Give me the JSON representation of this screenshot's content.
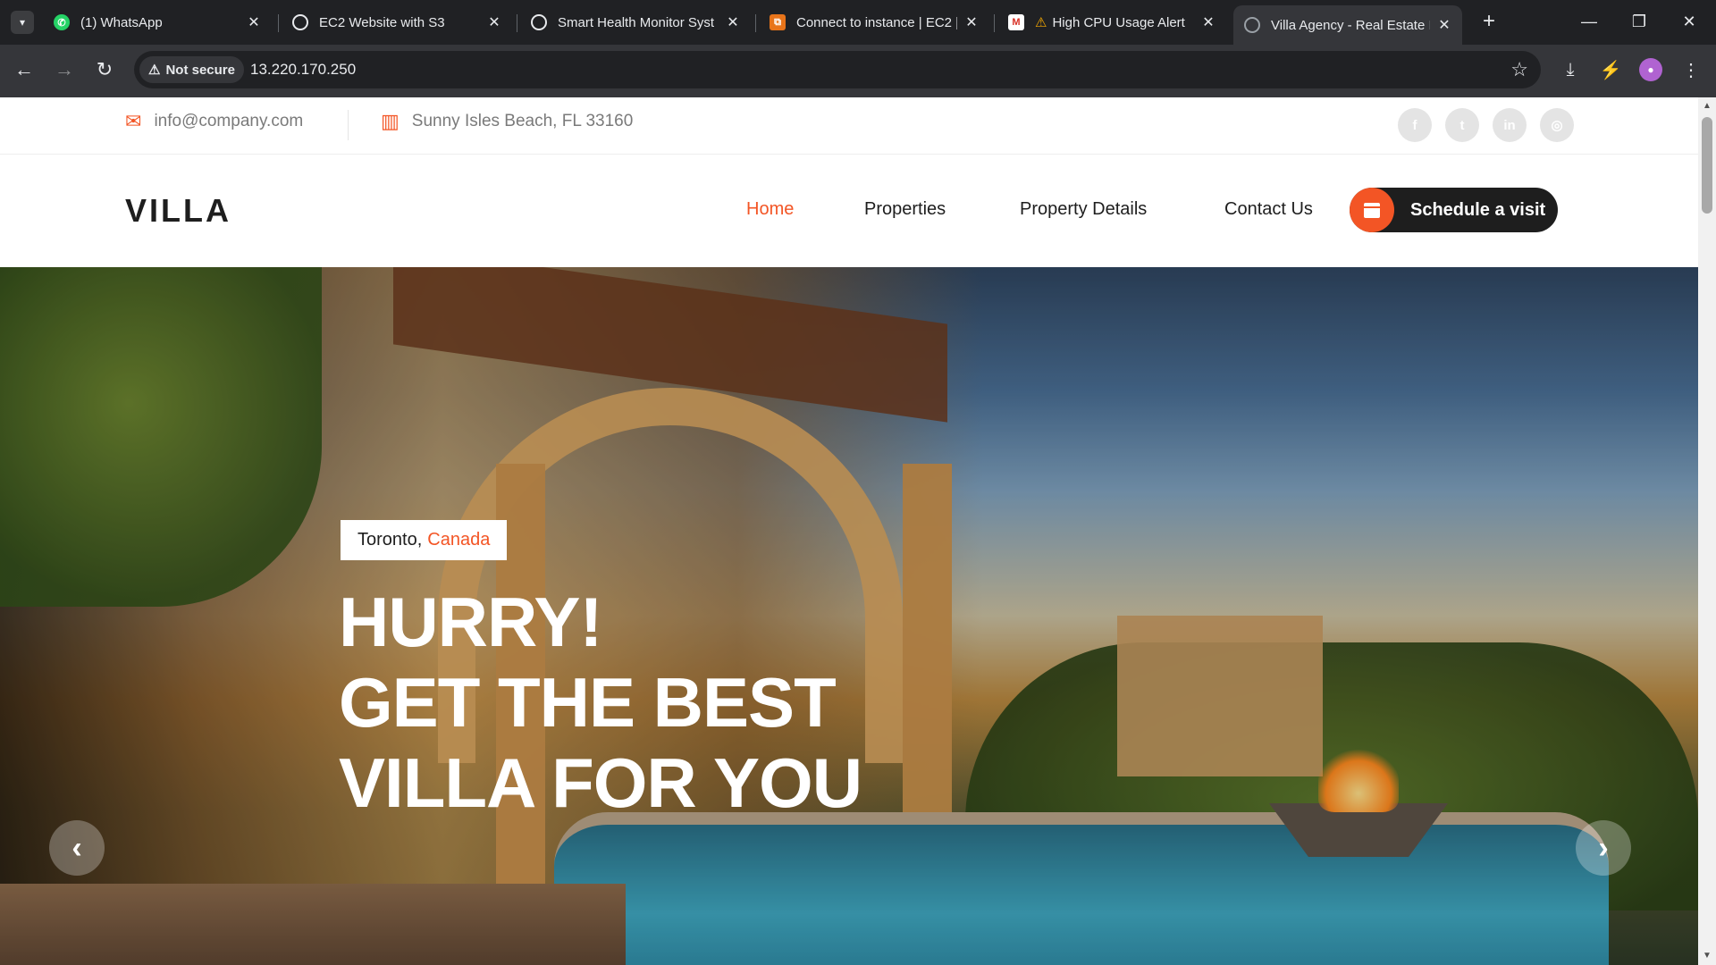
{
  "browser": {
    "tabs": [
      {
        "label": "(1) WhatsApp",
        "icon": "whatsapp-icon"
      },
      {
        "label": "EC2 Website with S3",
        "icon": "openai-icon"
      },
      {
        "label": "Smart Health Monitor Syst",
        "icon": "openai-icon"
      },
      {
        "label": "Connect to instance | EC2 |",
        "icon": "aws-icon"
      },
      {
        "label": "High CPU Usage Alert",
        "icon": "gmail-icon",
        "prefix": "⚠"
      },
      {
        "label": "Villa Agency - Real Estate I",
        "icon": "globe-icon"
      }
    ],
    "security_label": "Not secure",
    "url": "13.220.170.250"
  },
  "topbar": {
    "email": "info@company.com",
    "address": "Sunny Isles Beach, FL 33160",
    "social": [
      "facebook-icon",
      "twitter-icon",
      "linkedin-icon",
      "instagram-icon"
    ]
  },
  "nav": {
    "logo": "VILLA",
    "links": [
      "Home",
      "Properties",
      "Property Details",
      "Contact Us"
    ],
    "active": "Home",
    "cta": "Schedule a visit"
  },
  "hero": {
    "city": "Toronto,",
    "country": "Canada",
    "headline_1": "HURRY!",
    "headline_2": "GET THE BEST",
    "headline_3": "VILLA FOR YOU"
  },
  "colors": {
    "accent": "#f35525",
    "dark": "#1e1e1e",
    "muted": "#7a7a7a"
  }
}
